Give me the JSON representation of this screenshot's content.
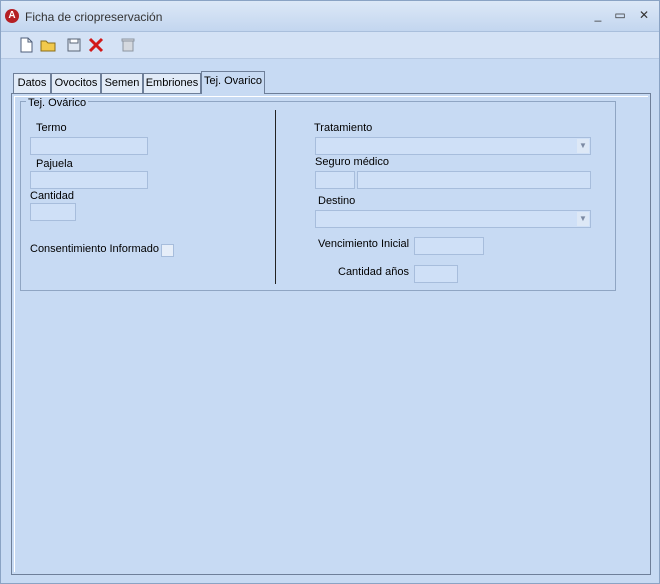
{
  "window": {
    "title": "Ficha de criopreservación"
  },
  "toolbar": {
    "icons": [
      "new-document-icon",
      "open-folder-icon",
      "save-icon",
      "delete-icon",
      "trash-icon"
    ]
  },
  "tabs": [
    "Datos",
    "Ovocitos",
    "Semen",
    "Embriones",
    "Tej. Ovarico"
  ],
  "group": {
    "title": "Tej. Ovárico"
  },
  "form": {
    "termo": "Termo",
    "pajuela": "Pajuela",
    "cantidad": "Cantidad",
    "consentimiento": "Consentimiento Informado",
    "tratamiento": "Tratamiento",
    "seguro": "Seguro médico",
    "destino": "Destino",
    "vencimiento": "Vencimiento Inicial",
    "cantidad_anos": "Cantidad años"
  }
}
